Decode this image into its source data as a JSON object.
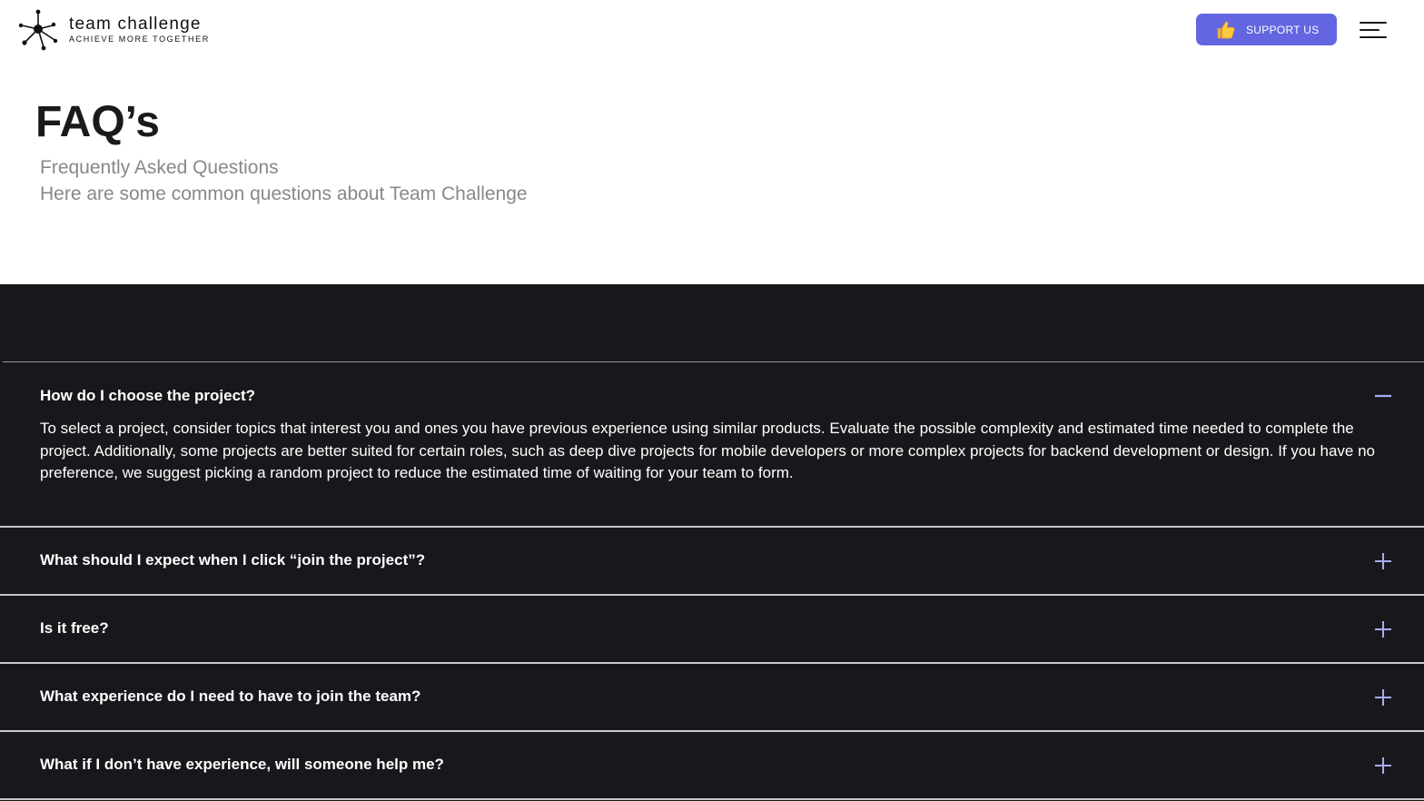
{
  "header": {
    "logo_name": "team challenge",
    "logo_tagline": "ACHIEVE MORE TOGETHER",
    "support_label": "SUPPORT US",
    "support_icon": "thumbs-up-icon",
    "menu_icon": "hamburger-menu-icon"
  },
  "intro": {
    "title": "FAQ’s",
    "subtitle": "Frequently Asked Questions",
    "description": "Here are some common questions about Team Challenge"
  },
  "colors": {
    "accent": "#6366e0",
    "dark_bg": "#18181c",
    "toggle_icon": "#a9abf2"
  },
  "faq": {
    "items": [
      {
        "question": "How do I choose the project?",
        "answer": "To select a project, consider topics that interest you and ones you have previous experience using similar products. Evaluate the possible complexity and estimated time needed to complete the project. Additionally, some projects are better suited for certain roles, such as deep dive projects for mobile developers or more complex projects for backend development or design. If you have no preference, we suggest picking a random project to reduce the estimated time of waiting for your team to form.",
        "expanded": true,
        "toggle_icon": "minus-icon"
      },
      {
        "question": "What should I expect when I click “join the project”?",
        "expanded": false,
        "toggle_icon": "plus-icon"
      },
      {
        "question": "Is it free?",
        "expanded": false,
        "toggle_icon": "plus-icon"
      },
      {
        "question": "What experience do I need to have to join the team?",
        "expanded": false,
        "toggle_icon": "plus-icon"
      },
      {
        "question": "What if I don’t have experience, will someone help me?",
        "expanded": false,
        "toggle_icon": "plus-icon"
      }
    ]
  }
}
